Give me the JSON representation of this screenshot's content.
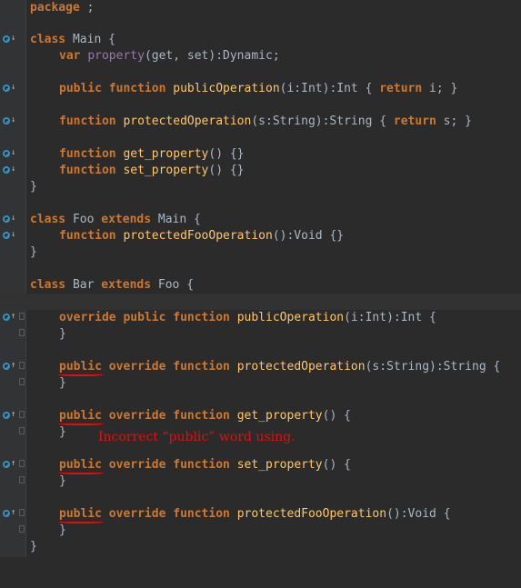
{
  "lines": {
    "l01": {
      "kw1": "package",
      "p1": " ;"
    },
    "l03": {
      "kw1": "class",
      "p1": " Main {"
    },
    "l04": {
      "kw1": "var",
      "v1": "property",
      "p1": "(get, set):Dynamic;"
    },
    "l06": {
      "kw1": "public",
      "kw2": "function",
      "m1": "publicOperation",
      "p1": "(i:Int):Int { ",
      "kw3": "return",
      "p2": " i; }"
    },
    "l08": {
      "kw1": "function",
      "m1": "protectedOperation",
      "p1": "(s:String):String { ",
      "kw2": "return",
      "p2": " s; }"
    },
    "l10": {
      "kw1": "function",
      "m1": "get_property",
      "p1": "() {}"
    },
    "l11": {
      "kw1": "function",
      "m1": "set_property",
      "p1": "() {}"
    },
    "l12": {
      "p1": "}"
    },
    "l14": {
      "kw1": "class",
      "p1": " Foo ",
      "kw2": "extends",
      "p2": " Main {"
    },
    "l15": {
      "kw1": "function",
      "m1": "protectedFooOperation",
      "p1": "():Void {}"
    },
    "l16": {
      "p1": "}"
    },
    "l18": {
      "kw1": "class",
      "p1": " Bar ",
      "kw2": "extends",
      "p2": " Foo {"
    },
    "l20": {
      "kw1": "override",
      "kw2": "public",
      "kw3": "function",
      "m1": "publicOperation",
      "p1": "(i:Int):Int {"
    },
    "l21": {
      "p1": "}"
    },
    "l23": {
      "kw1": "public",
      "kw2": "override",
      "kw3": "function",
      "m1": "protectedOperation",
      "p1": "(s:String):String {"
    },
    "l24": {
      "p1": "}"
    },
    "l26": {
      "kw1": "public",
      "kw2": "override",
      "kw3": "function",
      "m1": "get_property",
      "p1": "() {"
    },
    "l27": {
      "p1": "}"
    },
    "l29": {
      "kw1": "public",
      "kw2": "override",
      "kw3": "function",
      "m1": "set_property",
      "p1": "() {"
    },
    "l30": {
      "p1": "}"
    },
    "l32": {
      "kw1": "public",
      "kw2": "override",
      "kw3": "function",
      "m1": "protectedFooOperation",
      "p1": "():Void {"
    },
    "l33": {
      "p1": "}"
    },
    "l34": {
      "p1": "}"
    }
  },
  "annotation": "Incorrect “public” word using.",
  "gutter_icons": {
    "implemented": "implemented-down-arrow-icon",
    "overriding": "overriding-up-arrow-icon",
    "fold": "fold-marker-icon"
  },
  "colors": {
    "background": "#2b2b2b",
    "keyword": "#cc7832",
    "method": "#ffc66d",
    "field": "#9876aa",
    "plain": "#a9b7c6",
    "annotation": "#e01010"
  }
}
